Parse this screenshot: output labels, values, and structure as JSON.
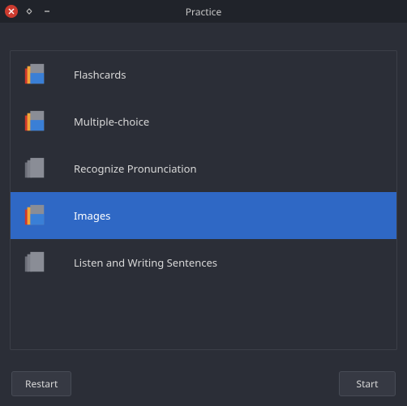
{
  "window": {
    "title": "Practice"
  },
  "practice_modes": [
    {
      "id": "flashcards",
      "label": "Flashcards",
      "colorful": true,
      "selected": false
    },
    {
      "id": "multiple-choice",
      "label": "Multiple-choice",
      "colorful": true,
      "selected": false
    },
    {
      "id": "recognize-pronunciation",
      "label": "Recognize Pronunciation",
      "colorful": false,
      "selected": false
    },
    {
      "id": "images",
      "label": "Images",
      "colorful": true,
      "selected": true
    },
    {
      "id": "listen-writing",
      "label": "Listen and Writing Sentences",
      "colorful": false,
      "selected": false
    }
  ],
  "buttons": {
    "restart": "Restart",
    "start": "Start"
  }
}
